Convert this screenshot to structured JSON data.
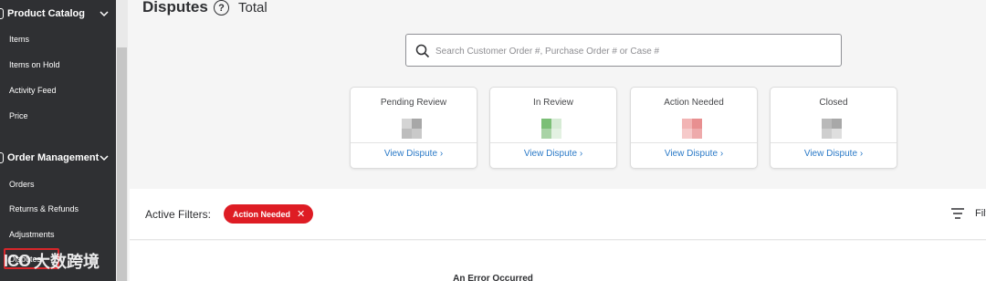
{
  "sidebar": {
    "sections": [
      {
        "label": "Product Catalog",
        "items": [
          {
            "label": "Items"
          },
          {
            "label": "Items on Hold"
          },
          {
            "label": "Activity Feed"
          },
          {
            "label": "Price"
          }
        ]
      },
      {
        "label": "Order Management",
        "items": [
          {
            "label": "Orders"
          },
          {
            "label": "Returns & Refunds"
          },
          {
            "label": "Adjustments"
          },
          {
            "label": "Disputes"
          }
        ]
      }
    ],
    "watermark": {
      "logo": "ICO",
      "text": "大数跨境"
    }
  },
  "header": {
    "title": "Disputes",
    "help_symbol": "?",
    "total_label": "Total"
  },
  "search": {
    "placeholder": "Search Customer Order #, Purchase Order # or Case #",
    "value": ""
  },
  "cards": [
    {
      "title": "Pending Review",
      "link": "View Dispute",
      "colors": [
        "#d4d4d4",
        "#a7a7a7",
        "#bdbdbd",
        "#c9c9c9"
      ]
    },
    {
      "title": "In Review",
      "link": "View Dispute",
      "colors": [
        "#7bbf76",
        "#d6ebd5",
        "#a9d3a6",
        "#e3f1e2"
      ]
    },
    {
      "title": "Action Needed",
      "link": "View Dispute",
      "colors": [
        "#f2b4b4",
        "#e88f90",
        "#f6caca",
        "#eeaaab"
      ]
    },
    {
      "title": "Closed",
      "link": "View Dispute",
      "colors": [
        "#b9b9b9",
        "#a8a8a8",
        "#cecece",
        "#dedede"
      ]
    }
  ],
  "filters": {
    "label": "Active Filters:",
    "chips": [
      {
        "label": "Action Needed",
        "remove": "✕"
      }
    ],
    "menu_label": "Filt"
  },
  "error": {
    "message": "An Error Occurred"
  },
  "colors": {
    "sidebar_bg": "#2f3033",
    "link": "#2b7ac7",
    "chip": "#de1c24",
    "highlight": "#d8262b"
  }
}
